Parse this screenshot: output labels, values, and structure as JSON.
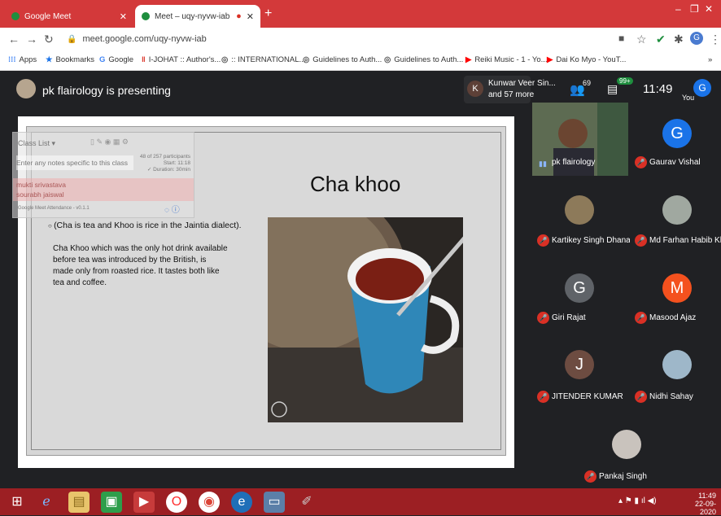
{
  "browser": {
    "tabs": [
      {
        "title": "Google Meet",
        "active": false
      },
      {
        "title": "Meet – uqy-nyvw-iab",
        "active": true
      }
    ],
    "url": "meet.google.com/uqy-nyvw-iab",
    "profile_initial": "G",
    "bookmarks": [
      "Apps",
      "Bookmarks",
      "Google",
      "I-JOHAT :: Author's...",
      ":: INTERNATIONAL...",
      "Guidelines to Auth...",
      "Guidelines to Auth...",
      "Reiki Music - 1 - Yo...",
      "Dai Ko Myo - YouT..."
    ],
    "more": "»"
  },
  "meet": {
    "presenting_text": "pk flairology is presenting",
    "participants_preview": {
      "initial": "K",
      "line1": "Kunwar Veer Sin...",
      "line2": "and 57 more"
    },
    "people_count": "69",
    "chat_badge": "99+",
    "time": "11:49",
    "you_label": "You",
    "you_initial": "G",
    "colors": {
      "red": "#d93025",
      "chat_green": "#1e8e3e"
    }
  },
  "attendance_overlay": {
    "header": "Class List",
    "placeholder": "Enter any notes specific to this class",
    "stats": [
      "48 of 257 participants",
      "Start: 11:18",
      "✓ Duration: 30min"
    ],
    "names": [
      "mukti srivastava",
      "sourabh jaiswal"
    ],
    "footer": "Google Meet Attendance - v0.1.1"
  },
  "slide": {
    "title": "Cha khoo",
    "bullet": "(Cha is tea and Khoo is rice in the Jaintia dialect).",
    "paragraph": "Cha Khoo which was the only hot drink available before tea was introduced by the British, is made only from roasted rice. It tastes both like tea and coffee."
  },
  "participants": [
    {
      "name": "pk flairology",
      "type": "video",
      "muted": false
    },
    {
      "name": "Gaurav Vishal",
      "initial": "G",
      "color": "#1a73e8",
      "muted": true
    },
    {
      "name": "Kartikey Singh Dhanai",
      "type": "photo",
      "muted": true
    },
    {
      "name": "Md Farhan Habib Kh...",
      "type": "photo",
      "muted": true
    },
    {
      "name": "Giri Rajat",
      "initial": "G",
      "color": "#5f6368",
      "muted": true
    },
    {
      "name": "Masood Ajaz",
      "initial": "M",
      "color": "#f4511e",
      "muted": true
    },
    {
      "name": "JITENDER KUMAR",
      "initial": "J",
      "color": "#6d4c41",
      "muted": true
    },
    {
      "name": "Nidhi Sahay",
      "type": "photo",
      "muted": true
    },
    {
      "name": "Pankaj Singh",
      "type": "photo",
      "muted": true
    }
  ],
  "taskbar": {
    "time": "11:49",
    "date": "22-09-2020",
    "icons": [
      "windows-start",
      "internet-explorer",
      "file-explorer",
      "store",
      "media",
      "opera",
      "chrome",
      "edge",
      "picture-viewer",
      "paint"
    ]
  }
}
